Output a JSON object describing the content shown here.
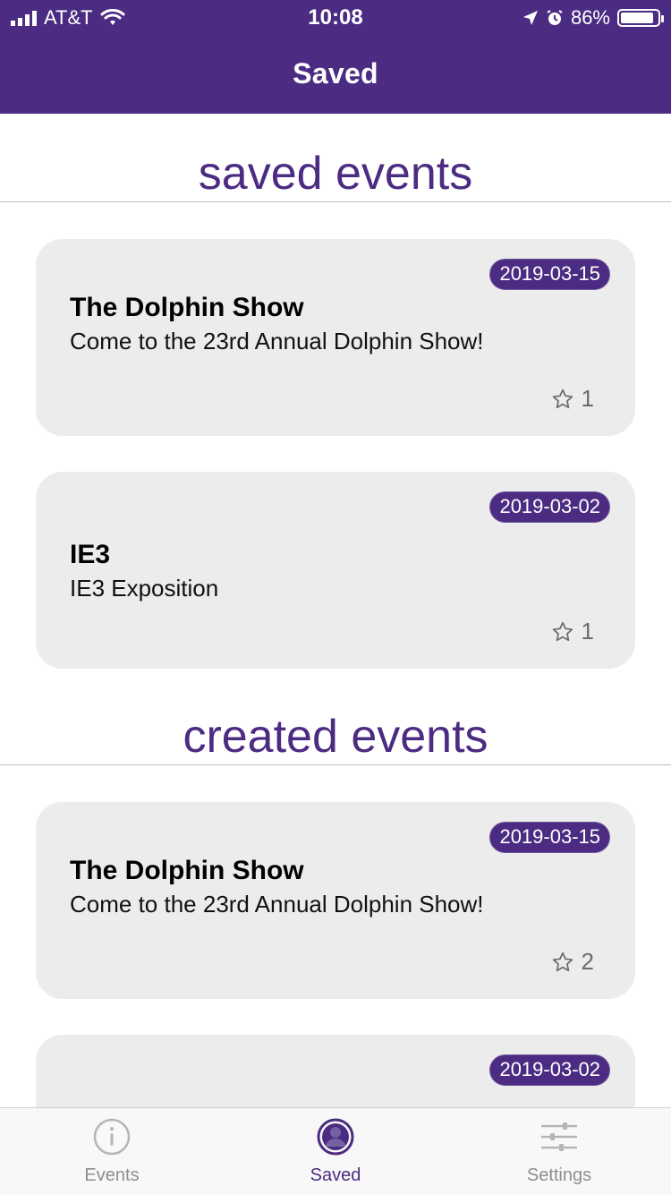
{
  "status_bar": {
    "carrier": "AT&T",
    "time": "10:08",
    "battery": "86%"
  },
  "header": {
    "title": "Saved"
  },
  "sections": {
    "saved_title": "saved events",
    "created_title": "created events"
  },
  "saved_events": [
    {
      "date": "2019-03-15",
      "title": "The Dolphin Show",
      "desc": "Come to the 23rd Annual Dolphin Show!",
      "count": "1"
    },
    {
      "date": "2019-03-02",
      "title": "IE3",
      "desc": "IE3 Exposition",
      "count": "1"
    }
  ],
  "created_events": [
    {
      "date": "2019-03-15",
      "title": "The Dolphin Show",
      "desc": "Come to the 23rd Annual Dolphin Show!",
      "count": "2"
    },
    {
      "date": "2019-03-02"
    }
  ],
  "tabs": [
    {
      "label": "Events",
      "icon": "info-icon"
    },
    {
      "label": "Saved",
      "icon": "user-circle-icon"
    },
    {
      "label": "Settings",
      "icon": "sliders-icon"
    }
  ],
  "colors": {
    "accent": "#4b2c82",
    "card": "#ececec"
  }
}
